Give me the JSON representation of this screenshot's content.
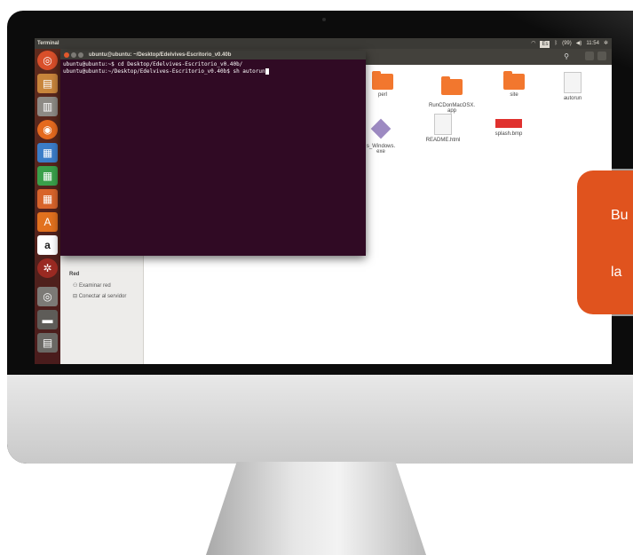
{
  "panel": {
    "title": "Terminal",
    "time": "11:54",
    "volume": "◀)",
    "keyboard": "Es",
    "battery": "(99)"
  },
  "terminal": {
    "title": "ubuntu@ubuntu: ~/Desktop/Edelvives-Escritorio_v0.40b",
    "lines": [
      "ubuntu@ubuntu:~$ cd Desktop/Edelvives-Escritorio_v0.40b/",
      "ubuntu@ubuntu:~/Desktop/Edelvives-Escritorio_v0.40b$ sh autorun"
    ]
  },
  "files": {
    "row1": [
      "perl",
      "RunCDonMacOSX.\napp",
      "site",
      "autorun"
    ],
    "row2": [
      "s_Windows.\nexe",
      "README.html",
      "splash.bmp"
    ]
  },
  "sidebar": {
    "network_heading": "Red",
    "items": [
      "Examinar red",
      "Conectar al servidor"
    ]
  },
  "callout": {
    "line1": "Bu",
    "line2": "la"
  },
  "launcher_icons": [
    "ubuntu-icon",
    "files-icon",
    "archive-icon",
    "firefox-icon",
    "writer-icon",
    "calc-icon",
    "impress-icon",
    "software-icon",
    "amazon-icon",
    "settings-icon",
    "disk-icon",
    "drive-icon",
    "trash-icon"
  ],
  "colors": {
    "terminal_bg": "#300a24",
    "accent": "#e0531e",
    "folder": "#f2772e"
  }
}
